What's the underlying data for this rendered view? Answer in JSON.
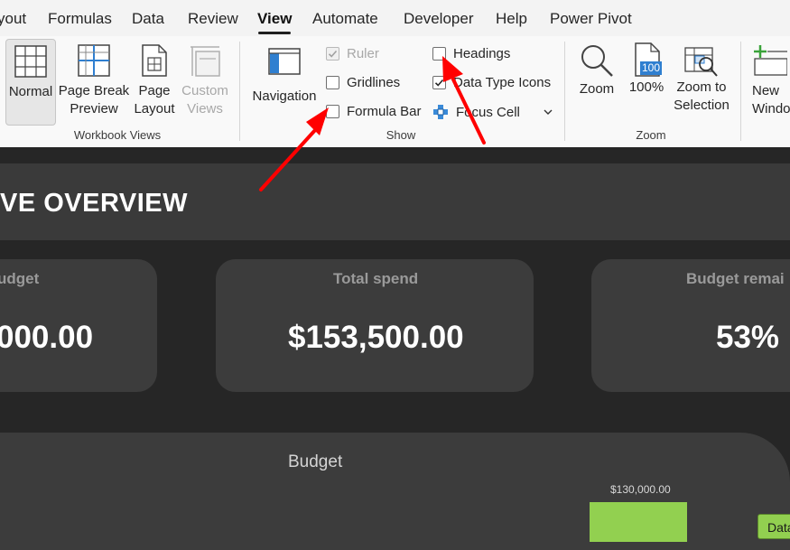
{
  "tabs": {
    "items": [
      "yout",
      "Formulas",
      "Data",
      "Review",
      "View",
      "Automate",
      "Developer",
      "Help",
      "Power Pivot"
    ],
    "active": "View"
  },
  "ribbon": {
    "workbook_views": {
      "group_label": "Workbook Views",
      "normal": "Normal",
      "page_break_preview": "Page Break\nPreview",
      "page_layout": "Page\nLayout",
      "custom_views": "Custom\nViews"
    },
    "show": {
      "group_label": "Show",
      "navigation": "Navigation",
      "ruler": "Ruler",
      "gridlines": "Gridlines",
      "formula_bar": "Formula Bar",
      "headings": "Headings",
      "data_type_icons": "Data Type Icons",
      "focus_cell": "Focus Cell",
      "states": {
        "ruler": true,
        "gridlines": false,
        "formula_bar": false,
        "headings": false,
        "data_type_icons": true
      }
    },
    "zoom": {
      "group_label": "Zoom",
      "zoom": "Zoom",
      "hundred": "100%",
      "hundred_icon": "100",
      "zoom_to_selection": "Zoom to\nSelection"
    },
    "window": {
      "new_window": "New\nWindo"
    }
  },
  "dashboard": {
    "title": "VE OVERVIEW",
    "cards": [
      {
        "label": "udget",
        "value": "000.00"
      },
      {
        "label": "Total spend",
        "value": "$153,500.00"
      },
      {
        "label": "Budget remai",
        "value": "53%"
      }
    ],
    "chart_title": "Budget",
    "data_button": "Data"
  },
  "chart_data": {
    "type": "bar",
    "title": "Budget",
    "data_labels": [
      "$130,000.00"
    ],
    "values": [
      130000
    ]
  },
  "colors": {
    "accent_green": "#92d050",
    "annotation_red": "#ff0000",
    "dashboard_bg": "#262626",
    "card_bg": "#3c3c3c"
  }
}
